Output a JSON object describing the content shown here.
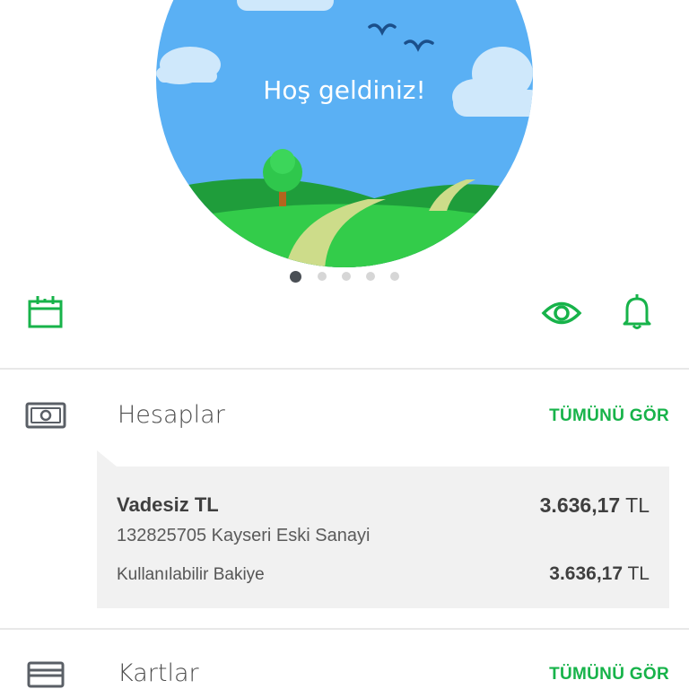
{
  "banner": {
    "greeting": "Hoş geldiniz!"
  },
  "carousel": {
    "slide_count": 5,
    "active_index": 0
  },
  "quick_actions": {
    "left_icon": "calendar-icon",
    "right_icons": [
      "eye-icon",
      "bell-icon"
    ]
  },
  "accounts_section": {
    "icon": "banknote-icon",
    "title": "Hesaplar",
    "see_all": "TÜMÜNÜ GÖR",
    "account": {
      "name": "Vadesiz TL",
      "balance_value": "3.636,17",
      "balance_currency": "TL",
      "number_branch": "132825705 Kayseri Eski Sanayi",
      "available_label": "Kullanılabilir Bakiye",
      "available_value": "3.636,17",
      "available_currency": "TL"
    }
  },
  "cards_section": {
    "icon": "credit-card-icon",
    "title": "Kartlar",
    "see_all": "TÜMÜNÜ GÖR"
  },
  "colors": {
    "accent_green": "#17b34a",
    "sky_blue": "#5ab0f4",
    "grass_green": "#2ec44a"
  }
}
